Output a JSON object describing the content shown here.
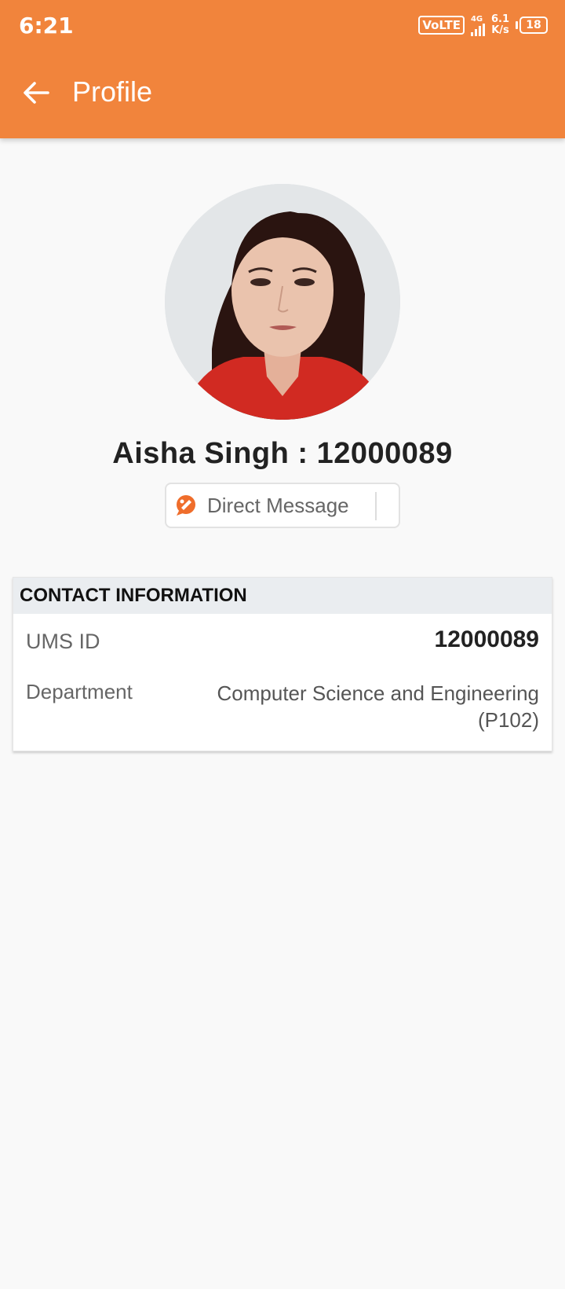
{
  "status_bar": {
    "time": "6:21",
    "volte": "VoLTE",
    "network": "4G",
    "speed_value": "6.1",
    "speed_unit": "K/s",
    "battery": "18"
  },
  "app_bar": {
    "title": "Profile",
    "color": "#f1843c"
  },
  "profile": {
    "name_line": "Aisha Singh : 12000089",
    "direct_message_label": "Direct Message"
  },
  "contact_card": {
    "header": "CONTACT INFORMATION",
    "rows": [
      {
        "label": "UMS ID",
        "value": "12000089"
      },
      {
        "label": "Department",
        "value": "Computer Science  and Engineering (P102)"
      }
    ]
  },
  "icons": {
    "back": "arrow-left-icon",
    "message": "chat-bubble-icon"
  }
}
